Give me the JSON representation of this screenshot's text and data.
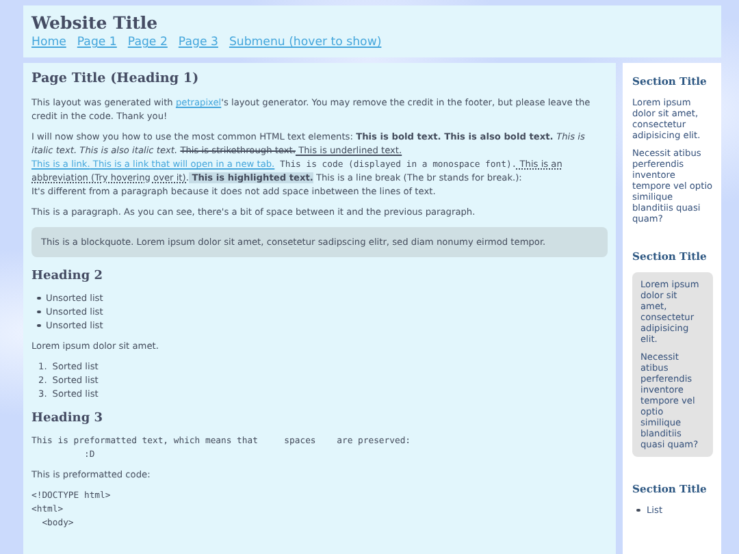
{
  "header": {
    "title": "Website Title",
    "nav": [
      {
        "label": "Home"
      },
      {
        "label": "Page 1"
      },
      {
        "label": "Page 2"
      },
      {
        "label": "Page 3"
      },
      {
        "label": "Submenu (hover to show)"
      }
    ]
  },
  "main": {
    "title": "Page Title (Heading 1)",
    "blocks": [
      {
        "kind": "paragraph",
        "segments": [
          {
            "kind": "text",
            "text": "This layout was generated with "
          },
          {
            "kind": "link",
            "text": "petrapixel"
          },
          {
            "kind": "text",
            "text": "'s layout generator. You may remove the credit in the footer, but please leave the credit in the code. Thank you!"
          }
        ]
      },
      {
        "kind": "paragraph",
        "segments": [
          {
            "kind": "text",
            "text": "I will now show you how to use the most common HTML text elements: "
          },
          {
            "kind": "bold",
            "text": "This is bold text. This is also bold text. "
          },
          {
            "kind": "italic",
            "text": "This is italic text. This is also italic text. "
          },
          {
            "kind": "strike",
            "text": "This is strikethrough text."
          },
          {
            "kind": "underline",
            "text": " This is underlined text."
          },
          {
            "kind": "link",
            "text": " This is a link."
          },
          {
            "kind": "link",
            "text": " This is a link that will open in a new tab."
          },
          {
            "kind": "code",
            "text": " This is code (displayed in a monospace font)."
          },
          {
            "kind": "abbr",
            "text": " This is an abbreviation (Try hovering over it)."
          },
          {
            "kind": "highlight",
            "text": " This is highlighted text."
          },
          {
            "kind": "text",
            "text": " This is a line break (The br stands for break.):"
          },
          {
            "kind": "break"
          },
          {
            "kind": "text",
            "text": "It's different from a paragraph because it does not add space inbetween the lines of text."
          }
        ]
      },
      {
        "kind": "paragraph",
        "segments": [
          {
            "kind": "text",
            "text": "This is a paragraph. As you can see, there's a bit of space between it and the previous paragraph."
          }
        ]
      },
      {
        "kind": "blockquote",
        "text": "This is a blockquote. Lorem ipsum dolor sit amet, consetetur sadipscing elitr, sed diam nonumy eirmod tempor."
      },
      {
        "kind": "heading",
        "text": "Heading 2"
      },
      {
        "kind": "bullets",
        "items": [
          "Unsorted list",
          "Unsorted list",
          "Unsorted list"
        ]
      },
      {
        "kind": "paragraph",
        "segments": [
          {
            "kind": "text",
            "text": "Lorem ipsum dolor sit amet."
          }
        ]
      },
      {
        "kind": "numbered",
        "items": [
          {
            "number": "1.",
            "text": "Sorted list"
          },
          {
            "number": "2.",
            "text": "Sorted list"
          },
          {
            "number": "3.",
            "text": "Sorted list"
          }
        ]
      },
      {
        "kind": "heading",
        "text": "Heading 3"
      },
      {
        "kind": "pre",
        "text": "This is preformatted text, which means that     spaces    are preserved:\n          :D"
      },
      {
        "kind": "paragraph",
        "segments": [
          {
            "kind": "text",
            "text": "This is preformatted code:"
          }
        ]
      },
      {
        "kind": "code",
        "lines": [
          "<!DOCTYPE html>",
          "<html>",
          "  <body>"
        ]
      }
    ]
  },
  "sidebar": [
    {
      "kind": "plain",
      "title": "Section Title",
      "paragraphs": [
        "Lorem ipsum dolor sit amet, consectetur adipisicing elit.",
        "Necessit atibus perferendis inventore tempore vel optio similique blanditiis quasi quam?"
      ]
    },
    {
      "kind": "boxed",
      "title": "Section Title",
      "paragraphs": [
        "Lorem ipsum dolor sit amet, consectetur adipisicing elit.",
        "Necessit atibus perferendis inventore tempore vel optio similique blanditiis quasi quam?"
      ]
    },
    {
      "kind": "list",
      "title": "Section Title",
      "items": [
        "List"
      ]
    }
  ]
}
